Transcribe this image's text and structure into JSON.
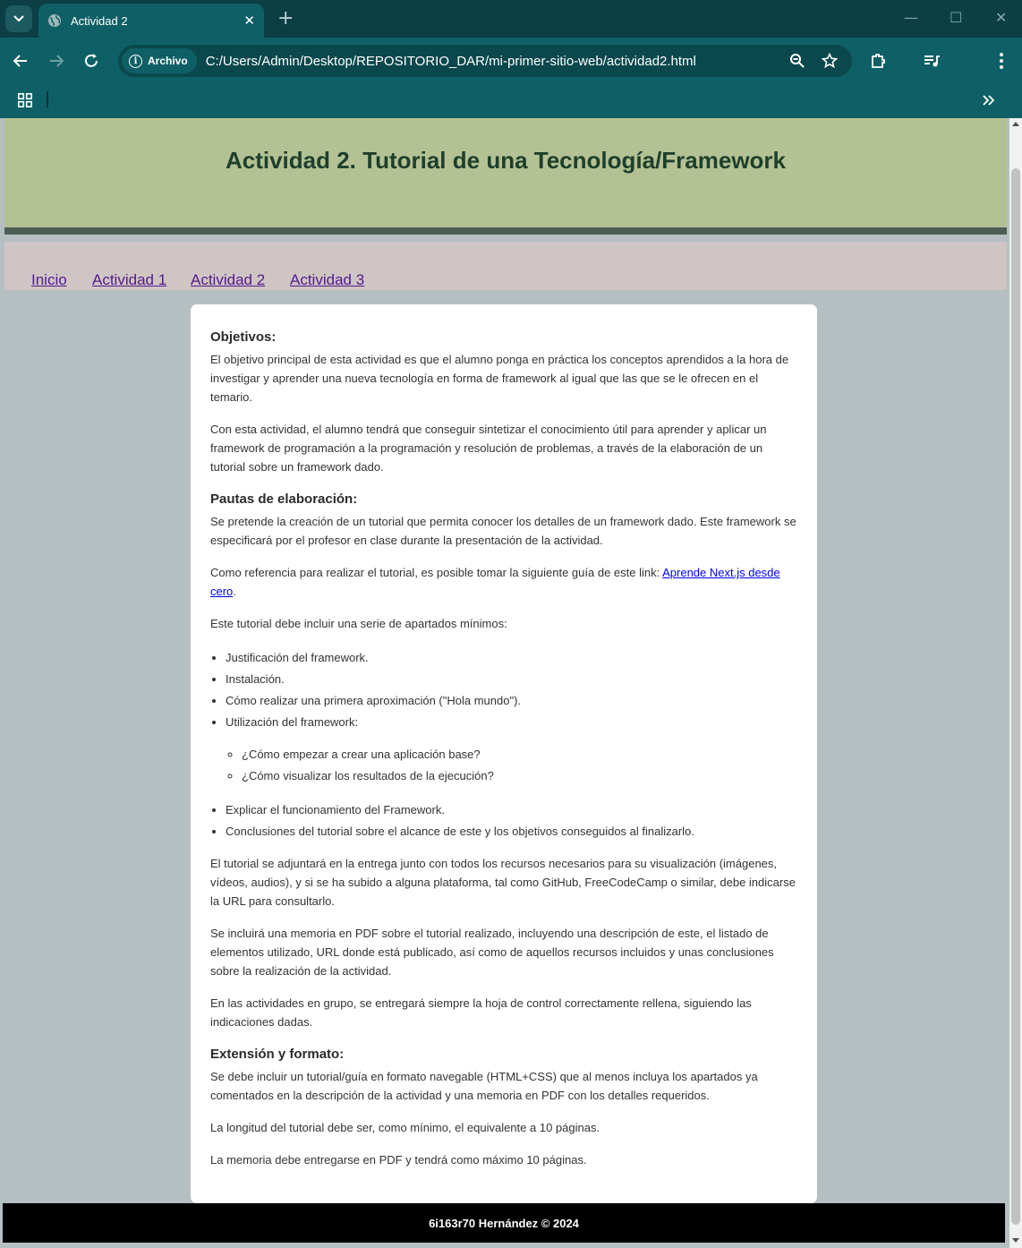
{
  "browser": {
    "tab_title": "Actividad 2",
    "new_tab_symbol": "+",
    "security_chip": "Archivo",
    "url": "C:/Users/Admin/Desktop/REPOSITORIO_DAR/mi-primer-sitio-web/actividad2.html",
    "icons": [
      "tab-search-icon",
      "globe-icon",
      "close-icon",
      "back-icon",
      "forward-icon",
      "reload-icon",
      "info-icon",
      "zoom-icon",
      "star-icon",
      "extensions-icon",
      "media-icon",
      "menu-icon",
      "apps-icon",
      "chevron-right-icon"
    ]
  },
  "site": {
    "header_title": "Actividad 2. Tutorial de una Tecnología/Framework",
    "nav": [
      "Inicio",
      "Actividad 1",
      "Actividad 2",
      "Actividad 3"
    ],
    "colors": {
      "header_bg": "#b3c194",
      "nav_bg": "#cfc5c5",
      "page_bg": "#b5bfc2",
      "title_color": "#1e3f2b"
    }
  },
  "content": {
    "objetivos": {
      "heading": "Objetivos:",
      "p1": "El objetivo principal de esta actividad es que el alumno ponga en práctica los conceptos aprendidos a la hora de investigar y aprender una nueva tecnología en forma de framework al igual que las que se le ofrecen en el temario.",
      "p2": "Con esta actividad, el alumno tendrá que conseguir sintetizar el conocimiento útil para aprender y aplicar un framework de programación a la programación y resolución de problemas, a través de la elaboración de un tutorial sobre un framework dado."
    },
    "pautas": {
      "heading": "Pautas de elaboración:",
      "p1": "Se pretende la creación de un tutorial que permita conocer los detalles de un framework dado. Este framework se especificará por el profesor en clase durante la presentación de la actividad.",
      "p2_prefix": "Como referencia para realizar el tutorial, es posible tomar la siguiente guía de este link: ",
      "p2_link": "Aprende Next.js desde cero",
      "p2_suffix": ".",
      "p3": "Este tutorial debe incluir una serie de apartados mínimos:",
      "list": [
        "Justificación del framework.",
        "Instalación.",
        "Cómo realizar una primera aproximación (\"Hola mundo\").",
        "Utilización del framework:"
      ],
      "sublist": [
        "¿Cómo empezar a crear una aplicación base?",
        "¿Cómo visualizar los resultados de la ejecución?"
      ],
      "list2": [
        "Explicar el funcionamiento del Framework.",
        "Conclusiones del tutorial sobre el alcance de este y los objetivos conseguidos al finalizarlo."
      ],
      "p4": "El tutorial se adjuntará en la entrega junto con todos los recursos necesarios para su visualización (imágenes, vídeos, audios), y si se ha subido a alguna plataforma, tal como GitHub, FreeCodeCamp o similar, debe indicarse la URL para consultarlo.",
      "p5": "Se incluirá una memoria en PDF sobre el tutorial realizado, incluyendo una descripción de este, el listado de elementos utilizado, URL donde está publicado, así como de aquellos recursos incluidos y unas conclusiones sobre la realización de la actividad.",
      "p6": "En las actividades en grupo, se entregará siempre la hoja de control correctamente rellena, siguiendo las indicaciones dadas."
    },
    "extension": {
      "heading": "Extensión y formato:",
      "p1": "Se debe incluir un tutorial/guía en formato navegable (HTML+CSS) que al menos incluya los apartados ya comentados en la descripción de la actividad y una memoria en PDF con los detalles requeridos.",
      "p2": "La longitud del tutorial debe ser, como mínimo, el equivalente a 10 páginas.",
      "p3": "La memoria debe entregarse en PDF y tendrá como máximo 10 páginas."
    }
  },
  "footer": {
    "text": "6i163r70 Hernández © 2024"
  }
}
